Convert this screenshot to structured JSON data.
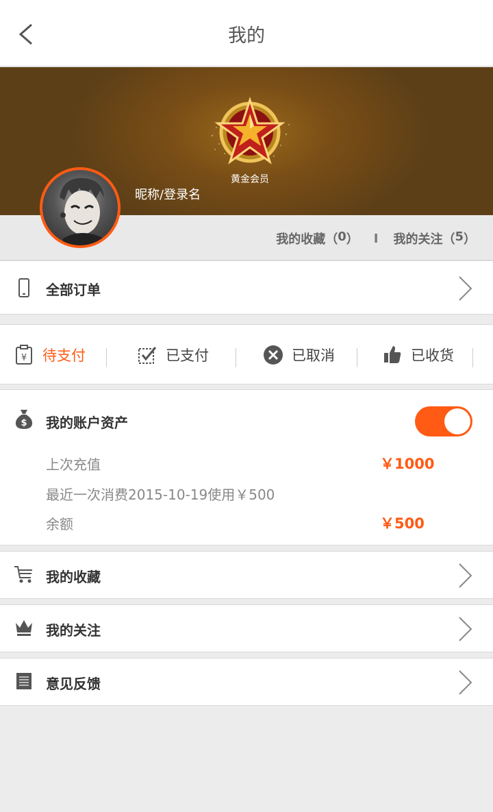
{
  "header": {
    "title": "我的",
    "back_icon": "chevron-left-icon"
  },
  "profile": {
    "badge_label": "黄金会员",
    "nickname": "昵称/登录名",
    "favorites_label": "我的收藏（",
    "favorites_count": "0",
    "favorites_close": "）",
    "separator": "I",
    "follows_label": "我的关注（",
    "follows_count": "5",
    "follows_close": "）"
  },
  "orders": {
    "label": "全部订单",
    "icon": "phone-icon"
  },
  "order_tabs": [
    {
      "label": "待支付",
      "icon": "yen-clipboard-icon",
      "active": true
    },
    {
      "label": "已支付",
      "icon": "checkbox-icon",
      "active": false
    },
    {
      "label": "已取消",
      "icon": "cancel-circle-icon",
      "active": false
    },
    {
      "label": "已收货",
      "icon": "thumbs-up-icon",
      "active": false
    }
  ],
  "assets": {
    "title": "我的账户资产",
    "toggle_on": true,
    "last_recharge_label": "上次充值",
    "last_recharge_amount": "￥1000",
    "last_spend_text": "最近一次消费2015-10-19使用￥500",
    "balance_label": "余额",
    "balance_amount": "￥500"
  },
  "menu": [
    {
      "label": "我的收藏",
      "icon": "cart-icon"
    },
    {
      "label": "我的关注",
      "icon": "crown-icon"
    },
    {
      "label": "意见反馈",
      "icon": "document-icon"
    }
  ],
  "colors": {
    "accent": "#ff5b14",
    "banner": "#6b4a1a",
    "background": "#ececec"
  }
}
